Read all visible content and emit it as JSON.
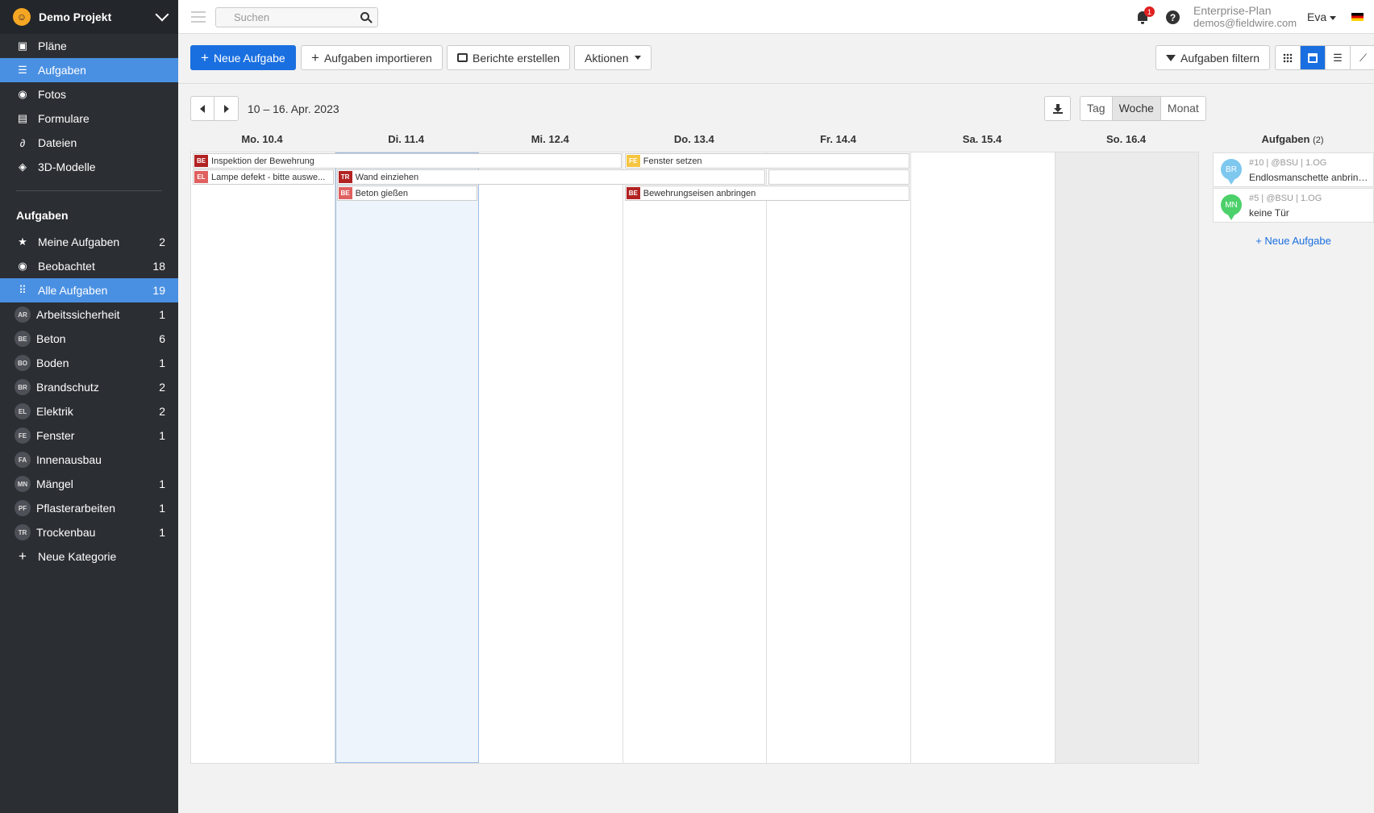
{
  "sidebar": {
    "project_name": "Demo Projekt",
    "nav": [
      {
        "label": "Pläne",
        "icon": "plans-icon"
      },
      {
        "label": "Aufgaben",
        "icon": "list-icon",
        "active": true
      },
      {
        "label": "Fotos",
        "icon": "camera-icon"
      },
      {
        "label": "Formulare",
        "icon": "clipboard-icon"
      },
      {
        "label": "Dateien",
        "icon": "paperclip-icon"
      },
      {
        "label": "3D-Modelle",
        "icon": "cube-icon"
      }
    ],
    "section_title": "Aufgaben",
    "filters": [
      {
        "label": "Meine Aufgaben",
        "count": "2",
        "icon": "star-icon"
      },
      {
        "label": "Beobachtet",
        "count": "18",
        "icon": "eye-icon"
      },
      {
        "label": "Alle Aufgaben",
        "count": "19",
        "icon": "grid-icon",
        "active": true
      }
    ],
    "categories": [
      {
        "abbr": "AR",
        "label": "Arbeitssicherheit",
        "count": "1"
      },
      {
        "abbr": "BE",
        "label": "Beton",
        "count": "6"
      },
      {
        "abbr": "BO",
        "label": "Boden",
        "count": "1"
      },
      {
        "abbr": "BR",
        "label": "Brandschutz",
        "count": "2"
      },
      {
        "abbr": "EL",
        "label": "Elektrik",
        "count": "2"
      },
      {
        "abbr": "FE",
        "label": "Fenster",
        "count": "1"
      },
      {
        "abbr": "FA",
        "label": "Innenausbau",
        "count": ""
      },
      {
        "abbr": "MN",
        "label": "Mängel",
        "count": "1"
      },
      {
        "abbr": "PF",
        "label": "Pflasterarbeiten",
        "count": "1"
      },
      {
        "abbr": "TR",
        "label": "Trockenbau",
        "count": "1"
      }
    ],
    "new_category": "Neue Kategorie"
  },
  "topbar": {
    "search_placeholder": "Suchen",
    "notifications": "1",
    "help": "?",
    "plan": "Enterprise-Plan",
    "email": "demos@fieldwire.com",
    "user": "Eva"
  },
  "toolbar": {
    "new_task": "Neue Aufgabe",
    "import": "Aufgaben importieren",
    "reports": "Berichte erstellen",
    "actions": "Aktionen",
    "filter": "Aufgaben filtern"
  },
  "calendar": {
    "date_range": "10 – 16. Apr. 2023",
    "ranges": [
      "Tag",
      "Woche",
      "Monat"
    ],
    "active_range": "Woche",
    "days": [
      "Mo. 10.4",
      "Di. 11.4",
      "Mi. 12.4",
      "Do. 13.4",
      "Fr. 14.4",
      "Sa. 15.4",
      "So. 16.4"
    ],
    "tasks": [
      {
        "tag": "BE",
        "label": "Inspektion der Bewehrung",
        "color": "#b22222",
        "start": 0,
        "span": 3,
        "row": 0
      },
      {
        "tag": "FE",
        "label": "Fenster setzen",
        "color": "#f5c542",
        "start": 3,
        "span": 2,
        "row": 0
      },
      {
        "tag": "EL",
        "label": "Lampe defekt - bitte auswe...",
        "color": "#e06060",
        "start": 0,
        "span": 1,
        "row": 1
      },
      {
        "tag": "TR",
        "label": "Wand einziehen",
        "color": "#b22222",
        "start": 1,
        "span": 3,
        "row": 1
      },
      {
        "tag": "",
        "label": "",
        "color": "#ffffff",
        "start": 4,
        "span": 1,
        "row": 1
      },
      {
        "tag": "BE",
        "label": "Beton gießen",
        "color": "#e06060",
        "start": 1,
        "span": 1,
        "row": 2
      },
      {
        "tag": "BE",
        "label": "Bewehrungseisen anbringen",
        "color": "#b22222",
        "start": 3,
        "span": 2,
        "row": 2
      }
    ]
  },
  "right_panel": {
    "title": "Aufgaben",
    "count": "(2)",
    "items": [
      {
        "pin": "BR",
        "pin_color": "#7ec8f0",
        "meta": "#10 | @BSU | 1.OG",
        "text": "Endlosmanschette anbringen"
      },
      {
        "pin": "MN",
        "pin_color": "#4cd06a",
        "meta": "#5 | @BSU | 1.OG",
        "text": "keine Tür"
      }
    ],
    "new_task": "+ Neue Aufgabe"
  }
}
